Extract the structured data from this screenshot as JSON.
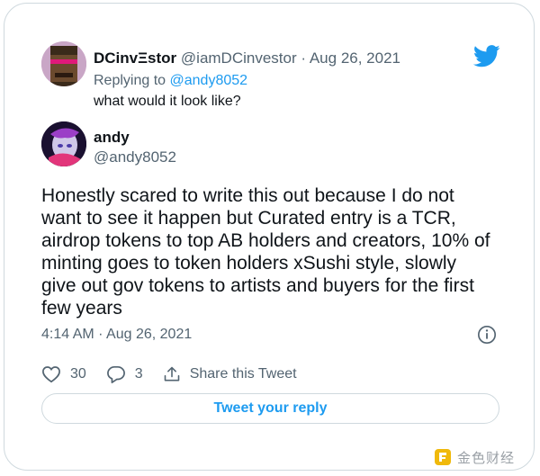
{
  "parent_tweet": {
    "display_name": "DCinvΞstor",
    "handle": "@iamDCinvestor",
    "separator": "·",
    "date": "Aug 26, 2021",
    "replying_to_label": "Replying to",
    "replying_to_handle": "@andy8052",
    "text": "what would it look like?"
  },
  "main_tweet": {
    "display_name": "andy",
    "handle": "@andy8052",
    "text_lines": [
      "Honestly scared to write this out because I do not",
      "want to see it happen but Curated entry is a TCR,",
      "airdrop tokens to top AB holders and creators, 10% of",
      "minting goes to token holders xSushi style, slowly",
      "give out gov tokens to artists and buyers for the first",
      "few years"
    ],
    "timestamp": "4:14 AM · Aug 26, 2021"
  },
  "actions": {
    "likes": "30",
    "replies": "3",
    "share_label": "Share this Tweet"
  },
  "reply_button_label": "Tweet your reply",
  "watermark_text": "金色财经",
  "colors": {
    "accent": "#1d9bf0",
    "secondary_text": "#536471",
    "border": "#cfd9de",
    "watermark": "#f0b90b"
  },
  "icons": [
    "twitter-bird-icon",
    "info-icon",
    "heart-icon",
    "reply-bubble-icon",
    "share-icon",
    "watermark-logo-icon"
  ]
}
